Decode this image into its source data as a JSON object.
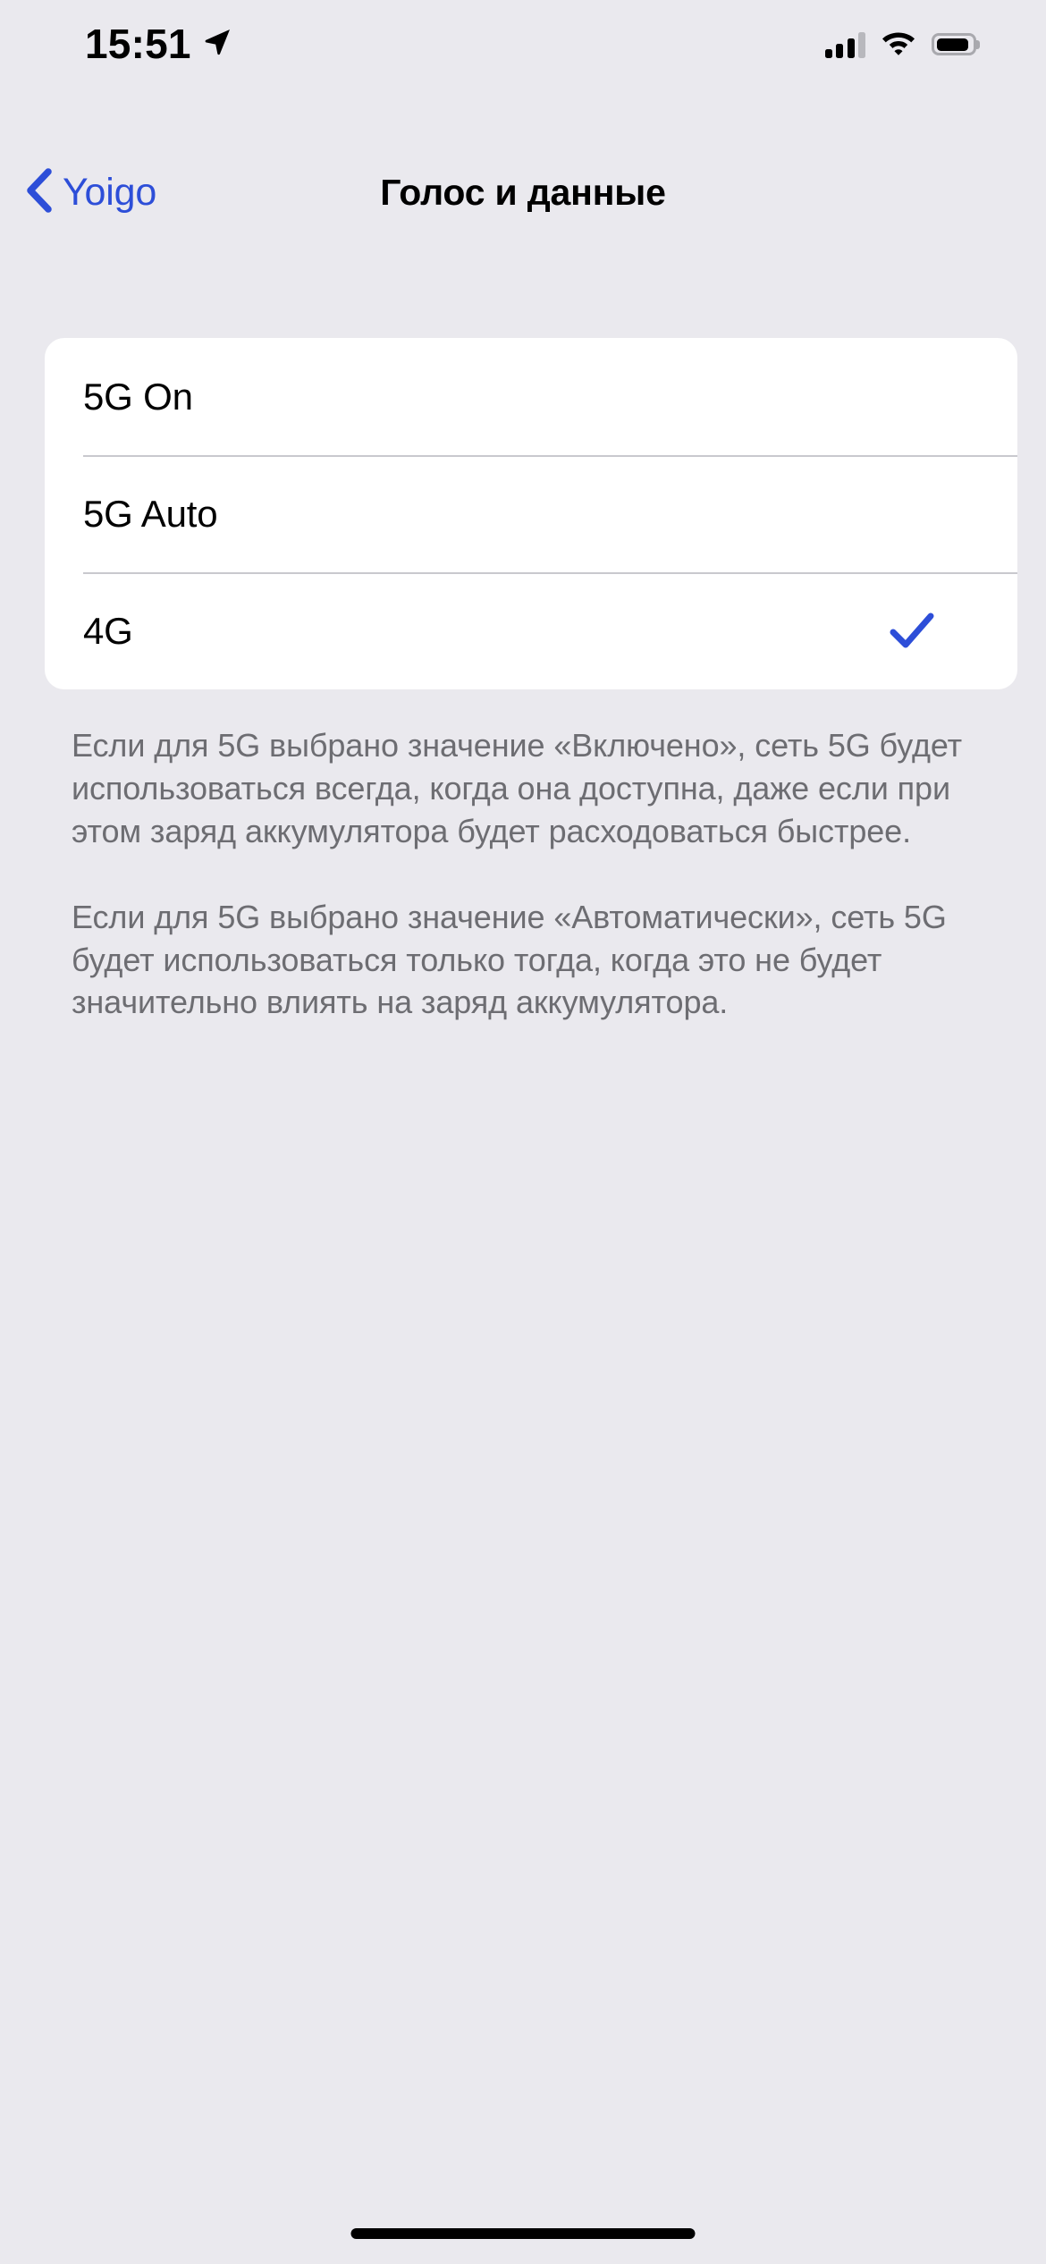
{
  "status_bar": {
    "time": "15:51",
    "location_icon": "location-arrow-icon",
    "signal_icon": "cellular-signal-icon",
    "signal_bars_filled": 3,
    "signal_bars_total": 4,
    "wifi_icon": "wifi-icon",
    "battery_icon": "battery-icon",
    "battery_level_percent": 92
  },
  "nav_bar": {
    "back_icon": "chevron-left-icon",
    "back_label": "Yoigo",
    "title": "Голос и данные"
  },
  "options": {
    "selected_index": 2,
    "items": [
      {
        "label": "5G On",
        "selected": false,
        "check_icon": "checkmark-icon"
      },
      {
        "label": "5G Auto",
        "selected": false,
        "check_icon": "checkmark-icon"
      },
      {
        "label": "4G",
        "selected": true,
        "check_icon": "checkmark-icon"
      }
    ]
  },
  "footer": {
    "notes": [
      "Если для 5G выбрано значение «Включено», сеть 5G будет использоваться всегда, когда она доступна, даже если при этом заряд аккумулятора будет расходоваться быстрее.",
      "Если для 5G выбрано значение «Автоматически», сеть 5G будет использоваться только тогда, когда это не будет значительно влиять на заряд аккумулятора."
    ]
  },
  "home_indicator": {
    "name": "home-indicator"
  },
  "colors": {
    "background": "#EAE9EE",
    "card": "#FFFFFF",
    "accent_blue": "#2D4ED8",
    "separator": "#C9C9CE",
    "footer_text": "#6D6D72",
    "primary_text": "#000000"
  }
}
